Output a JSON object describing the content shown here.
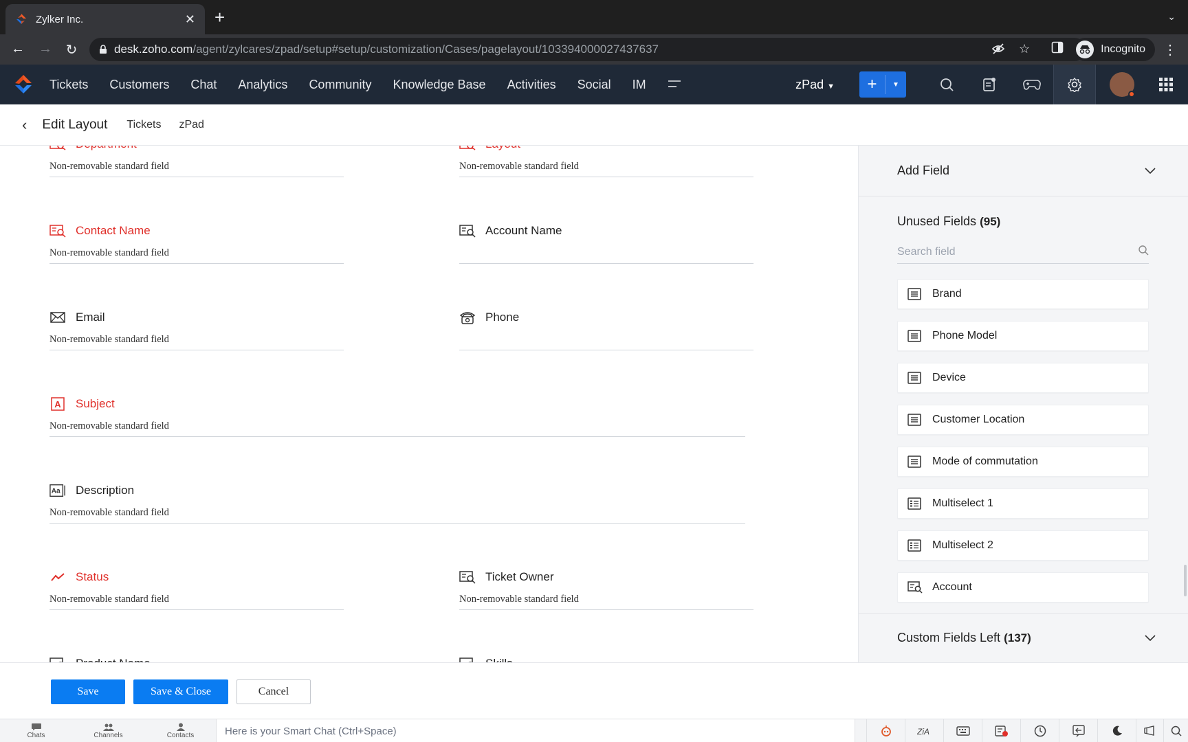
{
  "browser": {
    "tab_title": "Zylker Inc.",
    "url_domain": "desk.zoho.com",
    "url_path": "/agent/zylcares/zpad/setup#setup/customization/Cases/pagelayout/103394000027437637",
    "profile_label": "Incognito"
  },
  "nav": {
    "items": [
      "Tickets",
      "Customers",
      "Chat",
      "Analytics",
      "Community",
      "Knowledge Base",
      "Activities",
      "Social",
      "IM"
    ],
    "department": "zPad"
  },
  "subheader": {
    "title": "Edit Layout",
    "crumb1": "Tickets",
    "crumb2": "zPad"
  },
  "fields": {
    "department": {
      "label": "Department",
      "value": "Non-removable standard field",
      "required": true
    },
    "layout": {
      "label": "Layout",
      "value": "Non-removable standard field",
      "required": true
    },
    "contact_name": {
      "label": "Contact Name",
      "value": "Non-removable standard field",
      "required": true
    },
    "account_name": {
      "label": "Account Name",
      "value": ""
    },
    "email": {
      "label": "Email",
      "value": "Non-removable standard field"
    },
    "phone": {
      "label": "Phone",
      "value": ""
    },
    "subject": {
      "label": "Subject",
      "value": "Non-removable standard field",
      "required": true
    },
    "description": {
      "label": "Description",
      "value": "Non-removable standard field"
    },
    "status": {
      "label": "Status",
      "value": "Non-removable standard field",
      "required": true
    },
    "ticket_owner": {
      "label": "Ticket Owner",
      "value": "Non-removable standard field"
    },
    "product_name": {
      "label": "Product Name"
    },
    "skills": {
      "label": "Skills"
    }
  },
  "panel": {
    "add_field_title": "Add Field",
    "unused_title": "Unused Fields",
    "unused_count": "(95)",
    "search_placeholder": "Search field",
    "unused_fields": [
      "Brand",
      "Phone Model",
      "Device",
      "Customer Location",
      "Mode of commutation",
      "Multiselect 1",
      "Multiselect 2",
      "Account"
    ],
    "custom_title": "Custom Fields Left",
    "custom_count": "(137)"
  },
  "actions": {
    "save": "Save",
    "save_close": "Save & Close",
    "cancel": "Cancel"
  },
  "statusbar": {
    "chats": "Chats",
    "channels": "Channels",
    "contacts": "Contacts",
    "smart_chat_placeholder": "Here is your Smart Chat (Ctrl+Space)"
  },
  "colors": {
    "required_label": "#e0302b",
    "primary_button": "#0a7cf2",
    "app_nav_bg": "#1f2937"
  }
}
